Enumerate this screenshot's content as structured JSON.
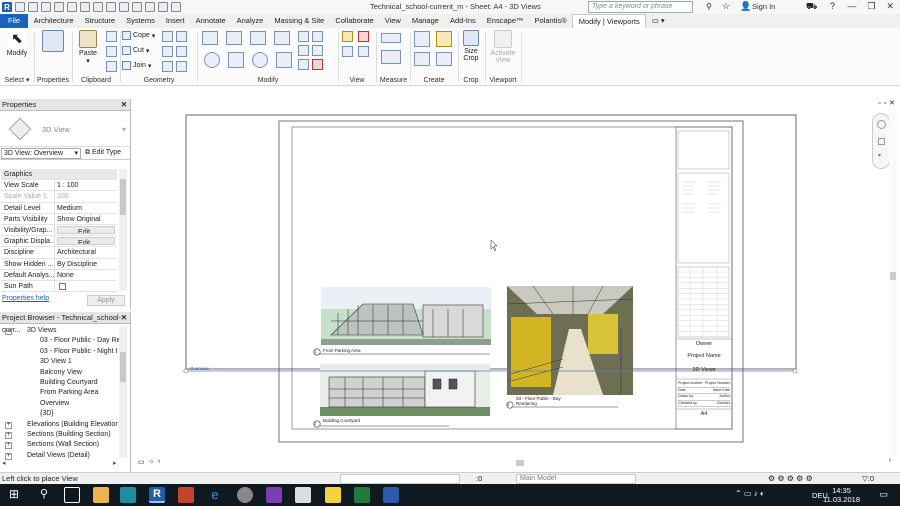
{
  "title_bar": {
    "document_title": "Technical_school-current_m - Sheet: A4 - 3D Views",
    "search_placeholder": "Type a keyword or phrase",
    "sign_in": "Sign In"
  },
  "tabs": [
    "File",
    "Architecture",
    "Structure",
    "Systems",
    "Insert",
    "Annotate",
    "Analyze",
    "Massing & Site",
    "Collaborate",
    "View",
    "Manage",
    "Add-Ins",
    "Enscape™",
    "Polantis®",
    "Modify | Viewports"
  ],
  "active_tab": "Modify | Viewports",
  "ribbon": {
    "select_group": {
      "modify_label": "Modify",
      "group_label": "Select"
    },
    "properties_group": {
      "group_label": "Properties"
    },
    "clipboard_group": {
      "paste_label": "Paste",
      "group_label": "Clipboard"
    },
    "geometry_group": {
      "cope": "Cope",
      "cut": "Cut",
      "join": "Join",
      "group_label": "Geometry"
    },
    "modify_group": {
      "group_label": "Modify"
    },
    "view_group": {
      "group_label": "View"
    },
    "measure_group": {
      "group_label": "Measure"
    },
    "create_group": {
      "group_label": "Create"
    },
    "crop_group": {
      "size_crop": "Size Crop",
      "group_label": "Crop"
    },
    "viewport_group": {
      "activate_view": "Activate View",
      "group_label": "Viewport"
    }
  },
  "properties": {
    "panel_title": "Properties",
    "type_name": "3D View",
    "view_selector": "3D View: Overview",
    "edit_type": "Edit Type",
    "rows": [
      {
        "k": "Graphics",
        "v": "",
        "section": true
      },
      {
        "k": "View Scale",
        "v": "1 : 100"
      },
      {
        "k": "Scale Value    1:",
        "v": "100",
        "grey": true
      },
      {
        "k": "Detail Level",
        "v": "Medium"
      },
      {
        "k": "Parts Visibility",
        "v": "Show Original"
      },
      {
        "k": "Visibility/Grap...",
        "v": "Edit...",
        "button": true
      },
      {
        "k": "Graphic Displa...",
        "v": "Edit...",
        "button": true
      },
      {
        "k": "Discipline",
        "v": "Architectural"
      },
      {
        "k": "Show Hidden ...",
        "v": "By Discipline"
      },
      {
        "k": "Default Analys...",
        "v": "None"
      },
      {
        "k": "Sun Path",
        "v": "",
        "checkbox": true
      }
    ],
    "help_link": "Properties help",
    "apply_label": "Apply"
  },
  "project_browser": {
    "panel_title": "Project Browser - Technical_school-curr...",
    "items": [
      {
        "label": "3D Views",
        "level": 1,
        "expander": "−"
      },
      {
        "label": "03 - Floor Public - Day Re",
        "level": 2
      },
      {
        "label": "03 - Floor Public - Night I",
        "level": 2
      },
      {
        "label": "3D View 1",
        "level": 2
      },
      {
        "label": "Balcony View",
        "level": 2
      },
      {
        "label": "Building Courtyard",
        "level": 2
      },
      {
        "label": "From Parking Area",
        "level": 2
      },
      {
        "label": "Overview",
        "level": 2
      },
      {
        "label": "{3D}",
        "level": 2
      },
      {
        "label": "Elevations (Building Elevatior",
        "level": 1,
        "expander": "+"
      },
      {
        "label": "Sections (Building Section)",
        "level": 1,
        "expander": "+"
      },
      {
        "label": "Sections (Wall Section)",
        "level": 1,
        "expander": "+"
      },
      {
        "label": "Detail Views (Detail)",
        "level": 1,
        "expander": "+"
      }
    ]
  },
  "sheet": {
    "viewport_label_overview": "Overview",
    "views": [
      {
        "number": "1",
        "title": "From Parking Area"
      },
      {
        "number": "2",
        "title": "Building Courtyard"
      },
      {
        "number": "3",
        "title": "03 - Floor Public - Day Rendering"
      }
    ],
    "title_block": {
      "owner": "Owner",
      "project_name": "Project Name",
      "sheet_name": "3D Views",
      "sheet_number": "A4",
      "fields": [
        {
          "k": "Project number",
          "v": "Project Number"
        },
        {
          "k": "Date",
          "v": "Issue Date"
        },
        {
          "k": "Drawn by",
          "v": "Author"
        },
        {
          "k": "Checked by",
          "v": "Checker"
        }
      ]
    }
  },
  "status_bar": {
    "text": "Left click to place View",
    "zero": ":0",
    "model": "Main Model",
    "filter": ":0"
  },
  "taskbar": {
    "time": "14:35",
    "date": "11.03.2018",
    "language": "DEU"
  }
}
